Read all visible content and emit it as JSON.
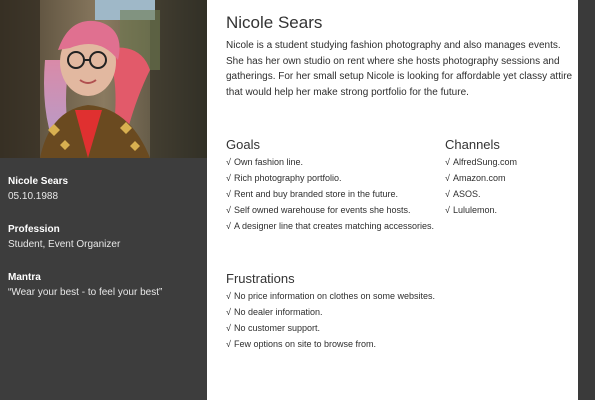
{
  "persona": {
    "name": "Nicole Sears",
    "birthdate": "05.10.1988",
    "profession_label": "Profession",
    "profession": "Student, Event Organizer",
    "mantra_label": "Mantra",
    "mantra": "“Wear your best - to feel your best”"
  },
  "card": {
    "name": "Nicole Sears",
    "bio": "Nicole is a student studying fashion photography and also manages events. She has her own studio on rent where she hosts photography sessions and gatherings. For her small setup Nicole is looking for affordable yet classy attire that would help her make strong portfolio for the future."
  },
  "check_glyph": "√",
  "goals": {
    "title": "Goals",
    "items": [
      "Own fashion line.",
      "Rich photography portfolio.",
      "Rent and buy branded store in the future.",
      "Self owned warehouse for events she hosts.",
      "A designer line that creates matching accessories."
    ]
  },
  "channels": {
    "title": "Channels",
    "items": [
      "AlfredSung.com",
      "Amazon.com",
      "ASOS.",
      "Lululemon."
    ]
  },
  "frustrations": {
    "title": "Frustrations",
    "items": [
      "No price information on clothes on some websites.",
      "No dealer information.",
      "No customer support.",
      "Few options on site to browse from."
    ]
  }
}
